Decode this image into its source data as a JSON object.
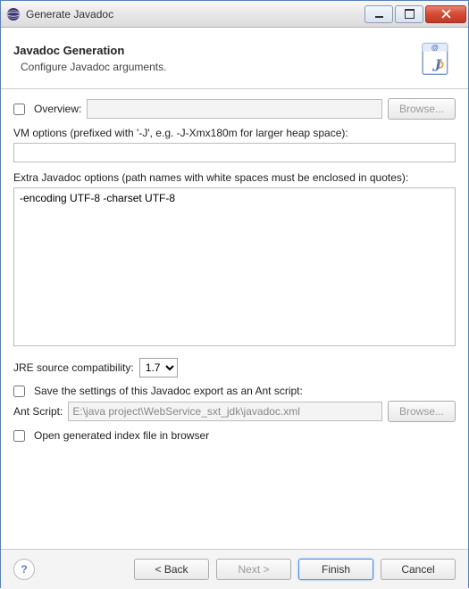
{
  "window": {
    "title": "Generate Javadoc"
  },
  "header": {
    "title": "Javadoc Generation",
    "subtitle": "Configure Javadoc arguments."
  },
  "overview": {
    "checkbox_label": "Overview:",
    "value": "",
    "browse_label": "Browse..."
  },
  "vm_options": {
    "label": "VM options (prefixed with '-J', e.g. -J-Xmx180m for larger heap space):",
    "value": ""
  },
  "extra_options": {
    "label": "Extra Javadoc options (path names with white spaces must be enclosed in quotes):",
    "value": "-encoding UTF-8 -charset UTF-8"
  },
  "jre": {
    "label": "JRE source compatibility:",
    "selected": "1.7"
  },
  "ant": {
    "save_label": "Save the settings of this Javadoc export as an Ant script:",
    "script_label": "Ant Script:",
    "script_value": "E:\\java project\\WebService_sxt_jdk\\javadoc.xml",
    "browse_label": "Browse..."
  },
  "open_index": {
    "label": "Open generated index file in browser"
  },
  "buttons": {
    "back": "< Back",
    "next": "Next >",
    "finish": "Finish",
    "cancel": "Cancel"
  },
  "help": {
    "symbol": "?"
  }
}
